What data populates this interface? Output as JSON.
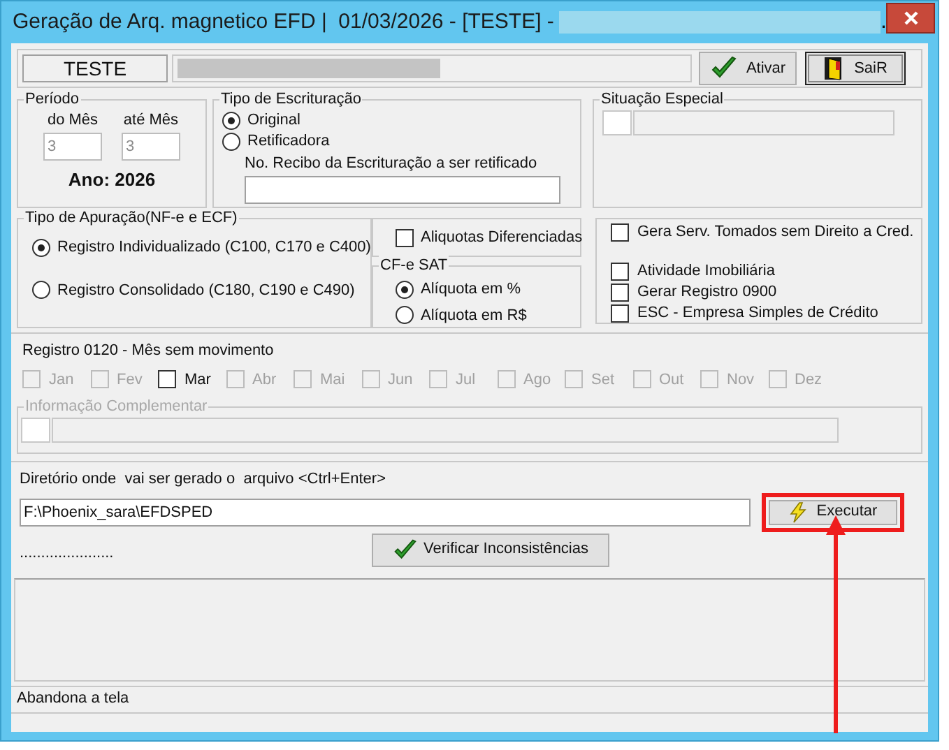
{
  "window": {
    "title": "Geração de Arq. magnetico EFD |  01/03/2026 - [TESTE] -",
    "title_end": "."
  },
  "header": {
    "company_code": "TESTE",
    "buttons": [
      {
        "label": "Ativar",
        "kind": "check"
      },
      {
        "label": "SaiR",
        "kind": "door"
      }
    ]
  },
  "periodo": {
    "title": "Período",
    "from_label": "do Mês",
    "from_value": "3",
    "to_label": "até Mês",
    "to_value": "3",
    "year": "Ano: 2026"
  },
  "tipo_escrituracao": {
    "title": "Tipo de Escrituração",
    "options": [
      {
        "label": "Original",
        "selected": true
      },
      {
        "label": "Retificadora",
        "selected": false
      }
    ],
    "recibo_label": "No. Recibo da Escrituração a ser retificado"
  },
  "situacao_especial": {
    "title": "Situação Especial"
  },
  "tipo_apuracao": {
    "title": "Tipo de Apuração(NF-e e ECF)",
    "options": [
      {
        "label": "Registro Individualizado (C100, C170 e C400)",
        "selected": true
      },
      {
        "label": "Registro Consolidado (C180, C190 e C490)",
        "selected": false
      }
    ]
  },
  "aliquotas_diferenciadas": {
    "label": "Aliquotas Diferenciadas",
    "checked": false
  },
  "cfe_sat": {
    "title": "CF-e SAT",
    "options": [
      {
        "label": "Alíquota em %",
        "selected": true
      },
      {
        "label": "Alíquota em R$",
        "selected": false
      }
    ]
  },
  "flags": [
    {
      "label": "Gera Serv. Tomados sem Direito a Cred.",
      "checked": false
    },
    {
      "label": "Atividade Imobiliária",
      "checked": false
    },
    {
      "label": "Gerar Registro 0900",
      "checked": false
    },
    {
      "label": "ESC - Empresa Simples de Crédito",
      "checked": false
    }
  ],
  "registro_0120": {
    "title": "Registro 0120 - Mês sem movimento",
    "months": [
      {
        "label": "Jan",
        "checked": false,
        "disabled": true
      },
      {
        "label": "Fev",
        "checked": false,
        "disabled": true
      },
      {
        "label": "Mar",
        "checked": false,
        "disabled": false
      },
      {
        "label": "Abr",
        "checked": false,
        "disabled": true
      },
      {
        "label": "Mai",
        "checked": false,
        "disabled": true
      },
      {
        "label": "Jun",
        "checked": false,
        "disabled": true
      },
      {
        "label": "Jul",
        "checked": false,
        "disabled": true
      },
      {
        "label": "Ago",
        "checked": false,
        "disabled": true
      },
      {
        "label": "Set",
        "checked": false,
        "disabled": true
      },
      {
        "label": "Out",
        "checked": false,
        "disabled": true
      },
      {
        "label": "Nov",
        "checked": false,
        "disabled": true
      },
      {
        "label": "Dez",
        "checked": false,
        "disabled": true
      }
    ]
  },
  "informacao_complementar": {
    "title": "Informação Complementar"
  },
  "diretorio": {
    "label": "Diretório onde  vai ser gerado o  arquivo <Ctrl+Enter>",
    "value": "F:\\Phoenix_sara\\EFDSPED",
    "execute_button": "Executar",
    "dots": "......................",
    "verify_button": "Verificar Inconsistências"
  },
  "status_bar": {
    "text": "Abandona a tela"
  }
}
